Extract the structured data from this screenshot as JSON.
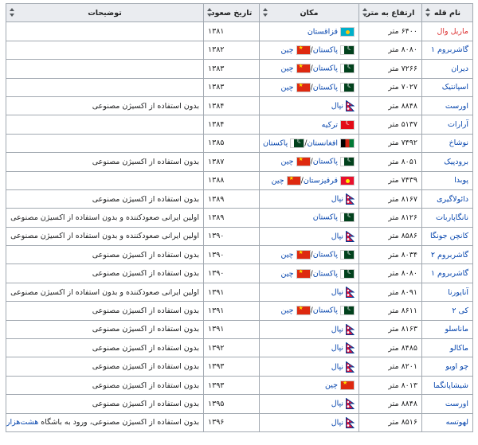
{
  "headers": {
    "name": "نام قله",
    "altitude": "ارتفاع به متر",
    "location": "مکان",
    "date": "تاریخ صعود",
    "notes": "توضیحات"
  },
  "rows": [
    {
      "name": "ماریل وال",
      "name_color": "#d33",
      "altitude": "۶۴۰۰ متر",
      "locations": [
        {
          "flag": "kz",
          "label": "قزاقستان"
        }
      ],
      "year": "۱۳۸۱",
      "notes": ""
    },
    {
      "name": "گاشربروم ۱",
      "altitude": "۸۰۸۰ متر",
      "locations": [
        {
          "flag": "pk",
          "label": "پاکستان"
        },
        {
          "flag": "cn",
          "label": "چین"
        }
      ],
      "year": "۱۳۸۲",
      "notes": ""
    },
    {
      "name": "دیران",
      "altitude": "۷۲۶۶ متر",
      "locations": [
        {
          "flag": "pk",
          "label": "پاکستان"
        },
        {
          "flag": "cn",
          "label": "چین"
        }
      ],
      "year": "۱۳۸۳",
      "notes": ""
    },
    {
      "name": "اسپانتیک",
      "altitude": "۷۰۲۷ متر",
      "locations": [
        {
          "flag": "pk",
          "label": "پاکستان"
        },
        {
          "flag": "cn",
          "label": "چین"
        }
      ],
      "year": "۱۳۸۳",
      "notes": ""
    },
    {
      "name": "اورست",
      "altitude": "۸۸۴۸ متر",
      "locations": [
        {
          "flag": "np",
          "label": "نپال"
        }
      ],
      "year": "۱۳۸۴",
      "notes": "بدون استفاده از اکسیژن مصنوعی"
    },
    {
      "name": "آرارات",
      "altitude": "۵۱۳۷ متر",
      "locations": [
        {
          "flag": "tr",
          "label": "ترکیه"
        }
      ],
      "year": "۱۳۸۴",
      "notes": ""
    },
    {
      "name": "نوشاخ",
      "altitude": "۷۴۹۲ متر",
      "locations": [
        {
          "flag": "af",
          "label": "افغانستان"
        },
        {
          "flag": "pk",
          "label": "پاکستان"
        }
      ],
      "year": "۱۳۸۵",
      "notes": ""
    },
    {
      "name": "برودپیک",
      "altitude": "۸۰۵۱ متر",
      "locations": [
        {
          "flag": "pk",
          "label": "پاکستان"
        },
        {
          "flag": "cn",
          "label": "چین"
        }
      ],
      "year": "۱۳۸۷",
      "notes": "بدون استفاده از اکسیژن مصنوعی"
    },
    {
      "name": "پوبدا",
      "altitude": "۷۴۳۹ متر",
      "locations": [
        {
          "flag": "kg",
          "label": "قرقیزستان"
        },
        {
          "flag": "cn",
          "label": "چین"
        }
      ],
      "year": "۱۳۸۸",
      "notes": ""
    },
    {
      "name": "دائولاگیری",
      "altitude": "۸۱۶۷ متر",
      "locations": [
        {
          "flag": "np",
          "label": "نپال"
        }
      ],
      "year": "۱۳۸۹",
      "notes": "بدون استفاده از اکسیژن مصنوعی"
    },
    {
      "name": "نانگاپاربات",
      "altitude": "۸۱۲۶ متر",
      "locations": [
        {
          "flag": "pk",
          "label": "پاکستان"
        }
      ],
      "year": "۱۳۸۹",
      "notes": "اولین ایرانی صعودکننده و بدون استفاده از اکسیژن مصنوعی"
    },
    {
      "name": "کانچن جونگا",
      "altitude": "۸۵۸۶ متر",
      "locations": [
        {
          "flag": "np",
          "label": "نپال"
        }
      ],
      "year": "۱۳۹۰",
      "notes": "اولین ایرانی صعودکننده و بدون استفاده از اکسیژن مصنوعی"
    },
    {
      "name": "گاشربروم ۲",
      "altitude": "۸۰۳۴ متر",
      "locations": [
        {
          "flag": "pk",
          "label": "پاکستان"
        },
        {
          "flag": "cn",
          "label": "چین"
        }
      ],
      "year": "۱۳۹۰",
      "notes": "بدون استفاده از اکسیژن مصنوعی"
    },
    {
      "name": "گاشربروم ۱",
      "altitude": "۸۰۸۰ متر",
      "locations": [
        {
          "flag": "pk",
          "label": "پاکستان"
        },
        {
          "flag": "cn",
          "label": "چین"
        }
      ],
      "year": "۱۳۹۰",
      "notes": "بدون استفاده از اکسیژن مصنوعی"
    },
    {
      "name": "آناپورنا",
      "altitude": "۸۰۹۱ متر",
      "locations": [
        {
          "flag": "np",
          "label": "نپال"
        }
      ],
      "year": "۱۳۹۱",
      "notes": "اولین ایرانی صعودکننده و بدون استفاده از اکسیژن مصنوعی"
    },
    {
      "name": "کی ۲",
      "altitude": "۸۶۱۱ متر",
      "locations": [
        {
          "flag": "pk",
          "label": "پاکستان"
        },
        {
          "flag": "cn",
          "label": "چین"
        }
      ],
      "year": "۱۳۹۱",
      "notes": "بدون استفاده از اکسیژن مصنوعی"
    },
    {
      "name": "ماناسلو",
      "altitude": "۸۱۶۳ متر",
      "locations": [
        {
          "flag": "np",
          "label": "نپال"
        }
      ],
      "year": "۱۳۹۱",
      "notes": "بدون استفاده از اکسیژن مصنوعی"
    },
    {
      "name": "ماکالو",
      "altitude": "۸۴۸۵ متر",
      "locations": [
        {
          "flag": "np",
          "label": "نپال"
        }
      ],
      "year": "۱۳۹۲",
      "notes": "بدون استفاده از اکسیژن مصنوعی"
    },
    {
      "name": "چو اویو",
      "altitude": "۸۲۰۱ متر",
      "locations": [
        {
          "flag": "np",
          "label": "نپال"
        }
      ],
      "year": "۱۳۹۳",
      "notes": "بدون استفاده از اکسیژن مصنوعی"
    },
    {
      "name": "شیشاپانگما",
      "altitude": "۸۰۱۳ متر",
      "locations": [
        {
          "flag": "cn",
          "label": "چین"
        }
      ],
      "year": "۱۳۹۳",
      "notes": "بدون استفاده از اکسیژن مصنوعی"
    },
    {
      "name": "اورست",
      "altitude": "۸۸۴۸ متر",
      "locations": [
        {
          "flag": "np",
          "label": "نپال"
        }
      ],
      "year": "۱۳۹۵",
      "notes": "بدون استفاده از اکسیژن مصنوعی"
    },
    {
      "name": "لهوتسه",
      "altitude": "۸۵۱۶ متر",
      "locations": [
        {
          "flag": "np",
          "label": "نپال"
        }
      ],
      "year": "۱۳۹۶",
      "notes": "بدون استفاده از اکسیژن مصنوعی، ورود به باشگاه ",
      "notes_link": "هشت‌هزارمتری‌ها",
      "notes_tail": "."
    }
  ]
}
